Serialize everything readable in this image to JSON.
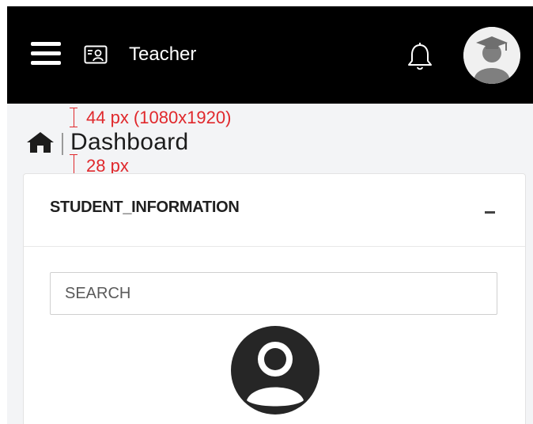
{
  "topbar": {
    "role_label": "Teacher",
    "menu_icon": "hamburger-menu-icon",
    "role_icon": "id-card-icon",
    "notification_icon": "bell-icon",
    "avatar_icon": "graduate-avatar"
  },
  "breadcrumb": {
    "home_icon": "home-icon",
    "title": "Dashboard"
  },
  "annotations": {
    "top_spacing": "44 px (1080x1920)",
    "bottom_spacing": "28 px"
  },
  "student_card": {
    "title": "STUDENT_INFORMATION",
    "collapse_icon": "minus-icon",
    "search_placeholder": "SEARCH",
    "search_value": "",
    "student_avatar_icon": "user-circle-icon"
  },
  "colors": {
    "topbar_bg": "#000000",
    "page_bg": "#f3f4f6",
    "annotation": "#e0282c",
    "card_bg": "#ffffff"
  }
}
